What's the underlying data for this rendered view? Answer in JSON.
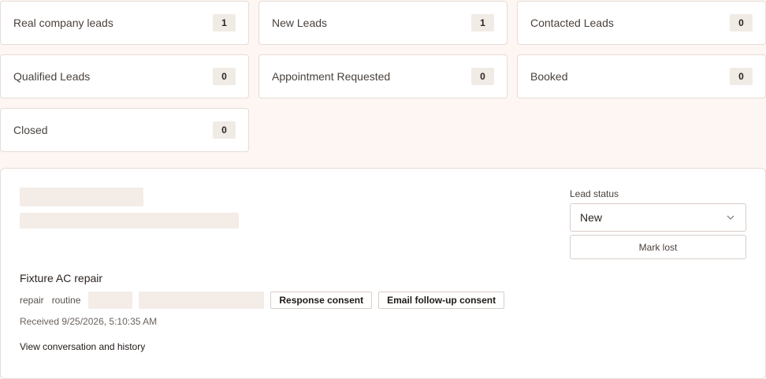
{
  "stats": [
    {
      "label": "Real company leads",
      "count": "1"
    },
    {
      "label": "New Leads",
      "count": "1"
    },
    {
      "label": "Contacted Leads",
      "count": "0"
    },
    {
      "label": "Qualified Leads",
      "count": "0"
    },
    {
      "label": "Appointment Requested",
      "count": "0"
    },
    {
      "label": "Booked",
      "count": "0"
    },
    {
      "label": "Closed",
      "count": "0"
    }
  ],
  "lead": {
    "status_label": "Lead status",
    "status_value": "New",
    "mark_lost_label": "Mark lost",
    "service_title": "Fixture AC repair",
    "tags": [
      "repair",
      "routine"
    ],
    "response_consent_label": "Response consent",
    "email_consent_label": "Email follow-up consent",
    "received": "Received 9/25/2026, 5:10:35 AM",
    "history_link": "View conversation and history"
  },
  "colors": {
    "background": "#fdf6f3",
    "card": "#ffffff",
    "skeleton": "#f4ece7",
    "border": "#e6dcd6"
  }
}
